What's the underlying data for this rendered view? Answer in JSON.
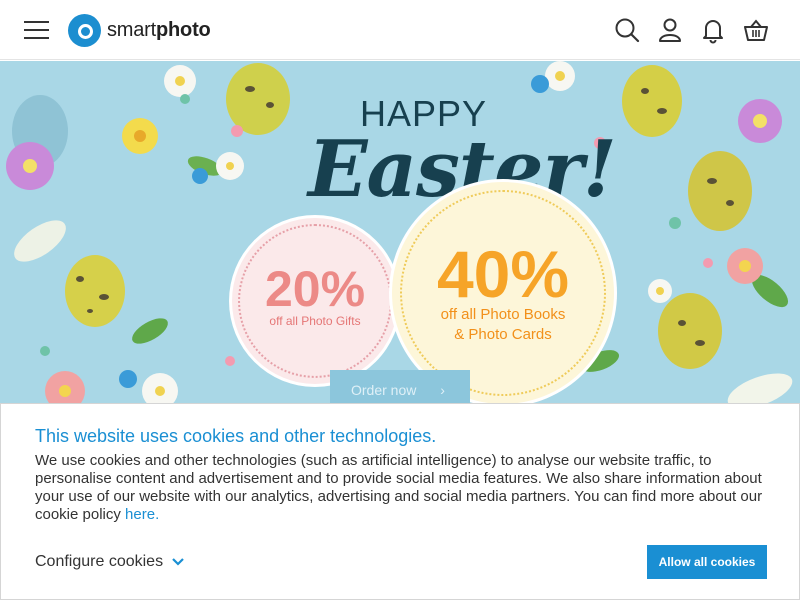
{
  "header": {
    "logo_prefix": "smart",
    "logo_suffix": "photo",
    "icons": [
      "menu-icon",
      "search-icon",
      "user-icon",
      "bell-icon",
      "basket-icon"
    ]
  },
  "hero": {
    "happy": "HAPPY",
    "easter": "Easter!",
    "offer1_pct": "20%",
    "offer1_text": "off all Photo Gifts",
    "offer2_pct": "40%",
    "offer2_text_line1": "off all Photo Books",
    "offer2_text_line2": "& Photo Cards",
    "order_label": "Order now"
  },
  "cookie": {
    "title": "This website uses cookies and other technologies.",
    "body": "We use cookies and other technologies (such as artificial intelligence) to analyse our website traffic, to personalise content and advertisement and to provide social media features. We also share information about your use of our website with our analytics, advertising and social media partners. You can find more about our cookie policy ",
    "link": "here",
    "link_suffix": ".",
    "configure_label": "Configure cookies",
    "allow_label": "Allow all cookies"
  },
  "colors": {
    "brand": "#1a8fd3",
    "hero_bg": "#a9d7e6",
    "easter_text": "#17404f",
    "offer1": "#ec8a87",
    "offer2": "#f6a428"
  }
}
